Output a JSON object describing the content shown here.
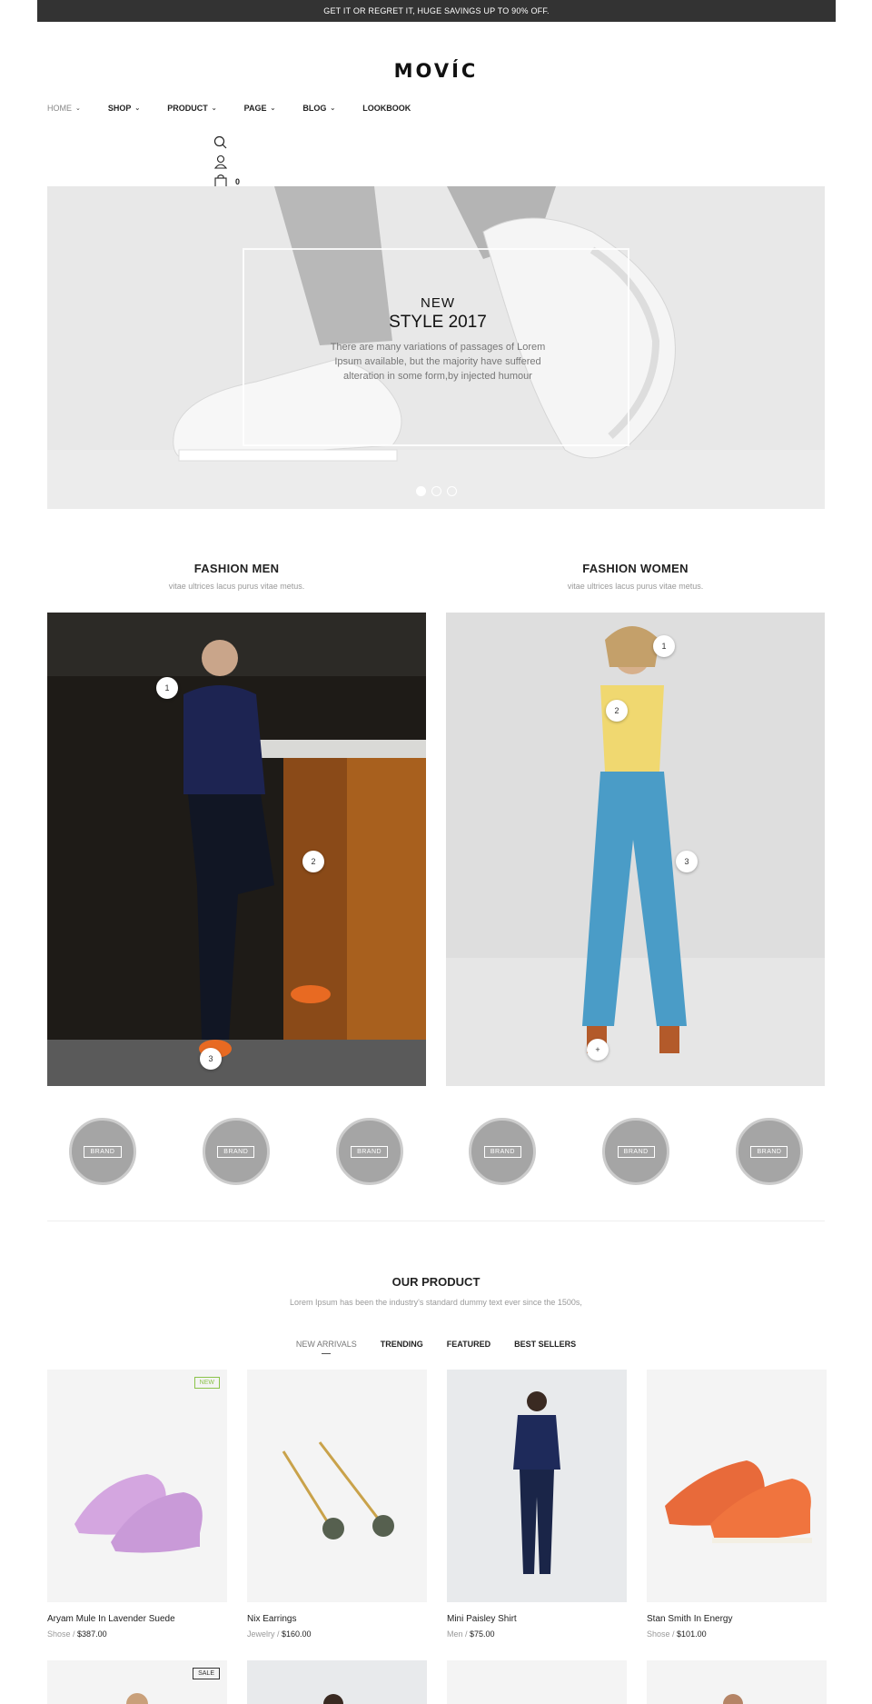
{
  "announcement": "GET IT OR REGRET IT, HUGE SAVINGS UP TO 90% OFF.",
  "logo": "MOVÍC",
  "nav": [
    {
      "label": "HOME",
      "has_dropdown": true
    },
    {
      "label": "SHOP",
      "has_dropdown": true
    },
    {
      "label": "PRODUCT",
      "has_dropdown": true
    },
    {
      "label": "PAGE",
      "has_dropdown": true
    },
    {
      "label": "BLOG",
      "has_dropdown": true
    },
    {
      "label": "LOOKBOOK",
      "has_dropdown": false
    }
  ],
  "header_icons": [
    "search-icon",
    "user-icon",
    "cart-icon"
  ],
  "cart_count": "0",
  "hero": {
    "kicker": "NEW",
    "title": "STYLE 2017",
    "description": "There are many variations of passages of Lorem Ipsum available, but the majority have suffered alteration in some form,by injected humour",
    "slides": 3,
    "active_slide": 1
  },
  "fashion_men": {
    "title": "FASHION MEN",
    "subtitle": "vitae ultrices lacus purus vitae metus.",
    "pins": [
      "1",
      "2",
      "3"
    ]
  },
  "fashion_women": {
    "title": "FASHION WOMEN",
    "subtitle": "vitae ultrices lacus purus vitae metus.",
    "pins": [
      "1",
      "2",
      "3",
      "+"
    ]
  },
  "brands": [
    "BRAND",
    "BRAND",
    "BRAND",
    "BRAND",
    "BRAND",
    "BRAND"
  ],
  "our_product": {
    "title": "OUR PRODUCT",
    "subtitle": "Lorem Ipsum has been the industry's standard dummy text ever since the 1500s,",
    "tabs": [
      "NEW ARRIVALS",
      "TRENDING",
      "FEATURED",
      "BEST SELLERS"
    ],
    "active_tab": "NEW ARRIVALS"
  },
  "products": [
    {
      "name": "Aryam Mule In Lavender Suede",
      "category": "Shose",
      "price": "$387.00",
      "badge": "NEW"
    },
    {
      "name": "Nix Earrings",
      "category": "Jewelry",
      "price": "$160.00",
      "badge": ""
    },
    {
      "name": "Mini Paisley Shirt",
      "category": "Men",
      "price": "$75.00",
      "badge": ""
    },
    {
      "name": "Stan Smith In Energy",
      "category": "Shose",
      "price": "$101.00",
      "badge": ""
    }
  ],
  "products_row2_badges": [
    "SALE",
    "",
    "",
    ""
  ],
  "colors": {
    "topbar": "#333333",
    "new_badge": "#8bc34a",
    "brand_circle": "#a5a5a5"
  }
}
